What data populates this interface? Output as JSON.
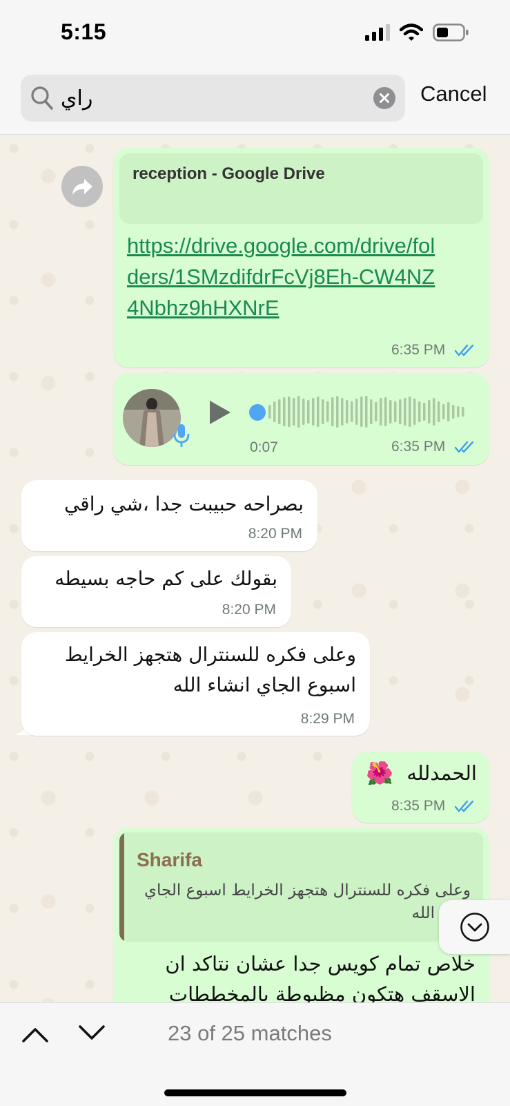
{
  "status_bar": {
    "time": "5:15"
  },
  "search": {
    "query": "راي",
    "cancel_label": "Cancel"
  },
  "messages": {
    "link": {
      "preview_title": "reception - Google Drive",
      "url_text": "https://drive.google.com/drive/folders/1SMzdifdrFcVj8Eh-CW4NZ4Nbhz9hHXNrE",
      "time": "6:35 PM"
    },
    "voice": {
      "duration": "0:07",
      "time": "6:35 PM"
    },
    "in1": {
      "text": "بصراحه حبيبت جدا ،شي راقي",
      "time": "8:20 PM"
    },
    "in2": {
      "text": "بقولك على كم حاجه بسيطه",
      "time": "8:20 PM"
    },
    "in3": {
      "line1": "وعلى فكره للسنترال هتجهز الخرايط",
      "line2": "اسبوع الجاي انشاء الله",
      "time": "8:29 PM"
    },
    "out1": {
      "text": "الحمدلله",
      "emoji": "🌺",
      "time": "8:35 PM"
    },
    "reply": {
      "author": "Sharifa",
      "quote_line1": "وعلى فكره للسنترال هتجهز الخرايط اسبوع الجاي",
      "quote_line2": "الله",
      "line1": "خلاص تمام كويس جدا عشان نتاكد ان",
      "line2": "الاسقف هتكون مظبوطة بالمخططات"
    }
  },
  "bottom_bar": {
    "matches_text": "23 of 25 matches"
  },
  "colors": {
    "outgoing_bubble": "#d9fdd3",
    "incoming_bubble": "#ffffff",
    "link": "#1a8a4c",
    "read_ticks": "#3b9ef0",
    "quote_author": "#8d6e4e"
  }
}
